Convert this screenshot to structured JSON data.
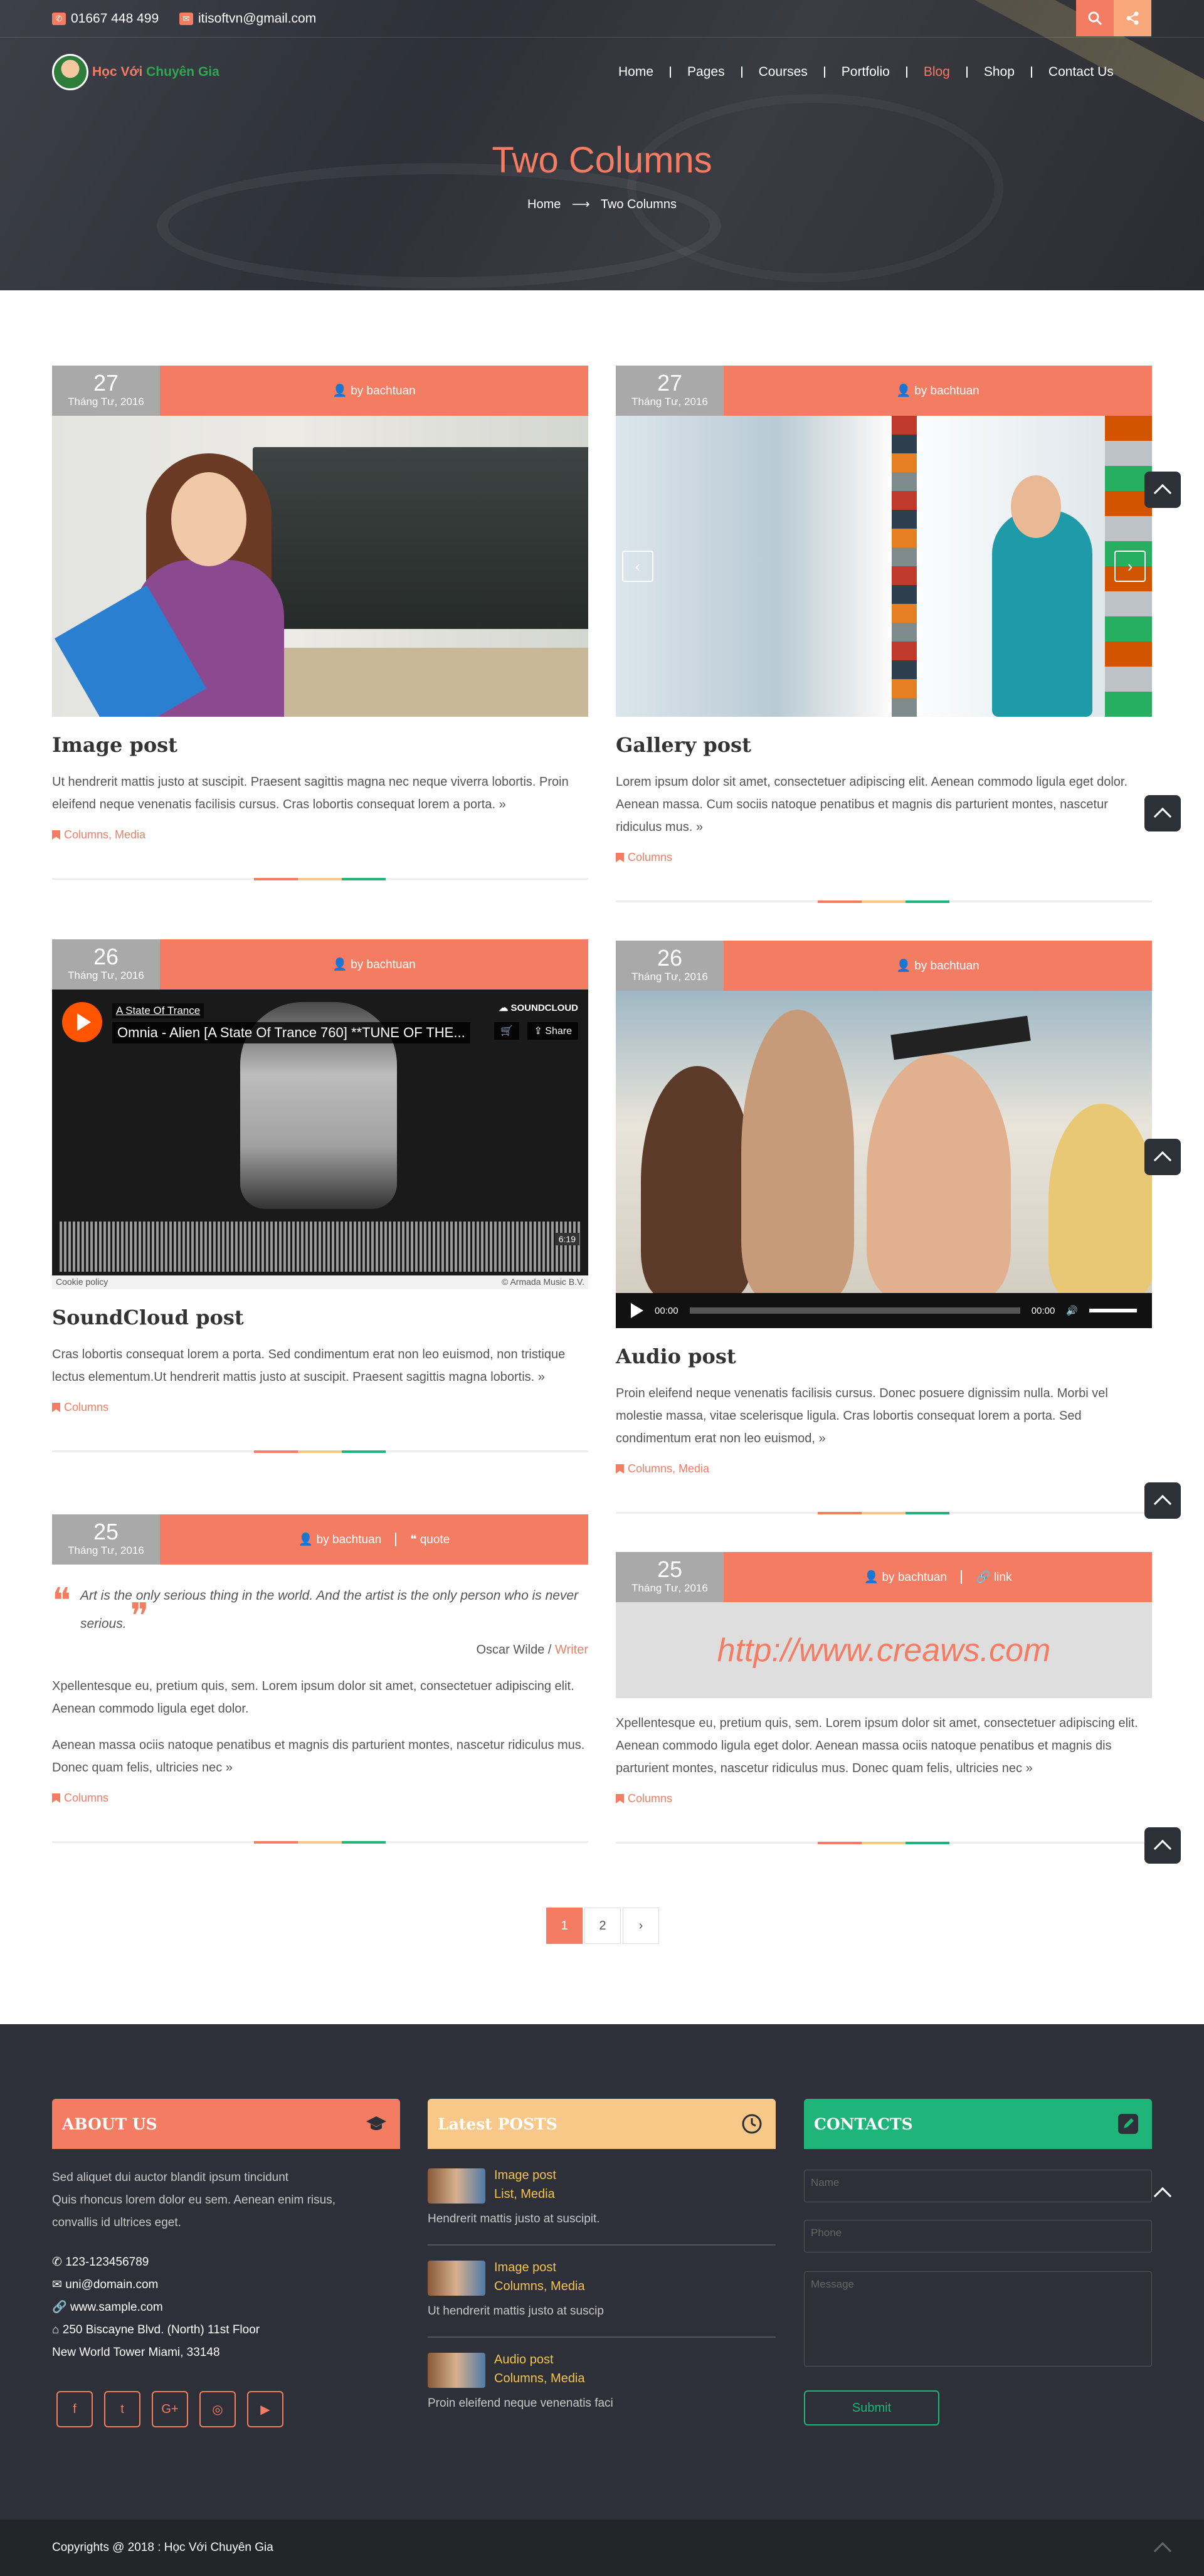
{
  "topbar": {
    "phone": "01667 448 499",
    "email": "itisoftvn@gmail.com"
  },
  "logo": {
    "text_a": "Học Với",
    "text_b": "Chuyên Gia"
  },
  "nav": [
    "Home",
    "Pages",
    "Courses",
    "Portfolio",
    "Blog",
    "Shop",
    "Contact Us"
  ],
  "hero": {
    "title": "Two Columns",
    "crumb_home": "Home",
    "crumb_current": "Two Columns"
  },
  "posts": [
    {
      "day": "27",
      "month": "Tháng Tư, 2016",
      "author": "by bachtuan",
      "title": "Image post",
      "excerpt": "Ut hendrerit mattis justo at suscipit. Praesent sagittis magna nec neque viverra lobortis. Proin eleifend neque venenatis facilisis cursus. Cras lobortis consequat lorem a porta.",
      "cats": "Columns, Media"
    },
    {
      "day": "27",
      "month": "Tháng Tư, 2016",
      "author": "by bachtuan",
      "title": "Gallery post",
      "excerpt": "Lorem ipsum dolor sit amet, consectetuer adipiscing elit. Aenean commodo ligula eget dolor. Aenean massa. Cum sociis natoque penatibus et magnis dis parturient montes, nascetur ridiculus mus.",
      "cats": "Columns"
    },
    {
      "day": "26",
      "month": "Tháng Tư, 2016",
      "author": "by bachtuan",
      "title": "SoundCloud post",
      "excerpt": "Cras lobortis consequat lorem a porta. Sed condimentum erat non leo euismod, non tristique lectus elementum.Ut hendrerit mattis justo at suscipit. Praesent sagittis magna lobortis.",
      "cats": "Columns"
    },
    {
      "day": "26",
      "month": "Tháng Tư, 2016",
      "author": "by bachtuan",
      "title": "Audio post",
      "excerpt": "Proin eleifend neque venenatis facilisis cursus. Donec posuere dignissim nulla. Morbi vel molestie massa, vitae scelerisque ligula. Cras lobortis consequat lorem a porta. Sed condimentum erat non leo euismod,",
      "cats": "Columns, Media"
    },
    {
      "day": "25",
      "month": "Tháng Tư, 2016",
      "author": "by bachtuan",
      "format": "quote",
      "quote": "Art is the only serious thing in the world. And the artist is the only person who is never serious.",
      "quote_author": "Oscar Wilde",
      "quote_role": "Writer",
      "excerpt": "Xpellentesque eu, pretium quis, sem. Lorem ipsum dolor sit amet, consectetuer adipiscing elit. Aenean commodo ligula eget dolor.",
      "excerpt2": "Aenean massa ociis natoque penatibus et magnis dis parturient montes, nascetur ridiculus mus. Donec quam felis, ultricies nec",
      "cats": "Columns"
    },
    {
      "day": "25",
      "month": "Tháng Tư, 2016",
      "author": "by bachtuan",
      "format": "link",
      "link": "http://www.creaws.com",
      "excerpt": "Xpellentesque eu, pretium quis, sem. Lorem ipsum dolor sit amet, consectetuer adipiscing elit. Aenean commodo ligula eget dolor. Aenean massa ociis natoque penatibus et magnis dis parturient montes, nascetur ridiculus mus. Donec quam felis, ultricies nec",
      "cats": "Columns"
    }
  ],
  "soundcloud": {
    "artist": "A State Of Trance",
    "track": "Omnia - Alien [A State Of Trance 760] **TUNE OF THE...",
    "brand": "SOUNDCLOUD",
    "share": "Share",
    "time": "6:19",
    "cookie": "Cookie policy",
    "credit": "© Armada Music B.V."
  },
  "audio": {
    "current": "00:00",
    "duration": "00:00"
  },
  "pager": [
    "1",
    "2",
    "›"
  ],
  "footer": {
    "about_title": "ABOUT US",
    "about_text1": "Sed aliquet dui auctor blandit ipsum tincidunt",
    "about_text2": "Quis rhoncus lorem dolor eu sem. Aenean enim risus,",
    "about_text3": "convallis id ultrices eget.",
    "phone": "123-123456789",
    "email": "uni@domain.com",
    "web": "www.sample.com",
    "addr1": "250 Biscayne Blvd. (North) 11st Floor",
    "addr2": "New World Tower Miami, 33148",
    "latest_title": "Latest POSTS",
    "latest": [
      {
        "title": "Image post",
        "cats": "List, Media",
        "excerpt": "Hendrerit mattis justo at suscipit."
      },
      {
        "title": "Image post",
        "cats": "Columns, Media",
        "excerpt": "Ut hendrerit mattis justo at suscip"
      },
      {
        "title": "Audio post",
        "cats": "Columns, Media",
        "excerpt": "Proin eleifend neque venenatis faci"
      }
    ],
    "contacts_title": "CONTACTS",
    "name_ph": "Name",
    "phone_ph": "Phone",
    "message_ph": "Message",
    "submit": "Submit",
    "copyright": "Copyrights @ 2018 : Học Với Chuyên Gia"
  },
  "colors": {
    "accent": "#f47c63",
    "footer_bg": "#2d3038",
    "latest_bar": "#f8c889",
    "contacts_bar": "#1fb47a"
  }
}
